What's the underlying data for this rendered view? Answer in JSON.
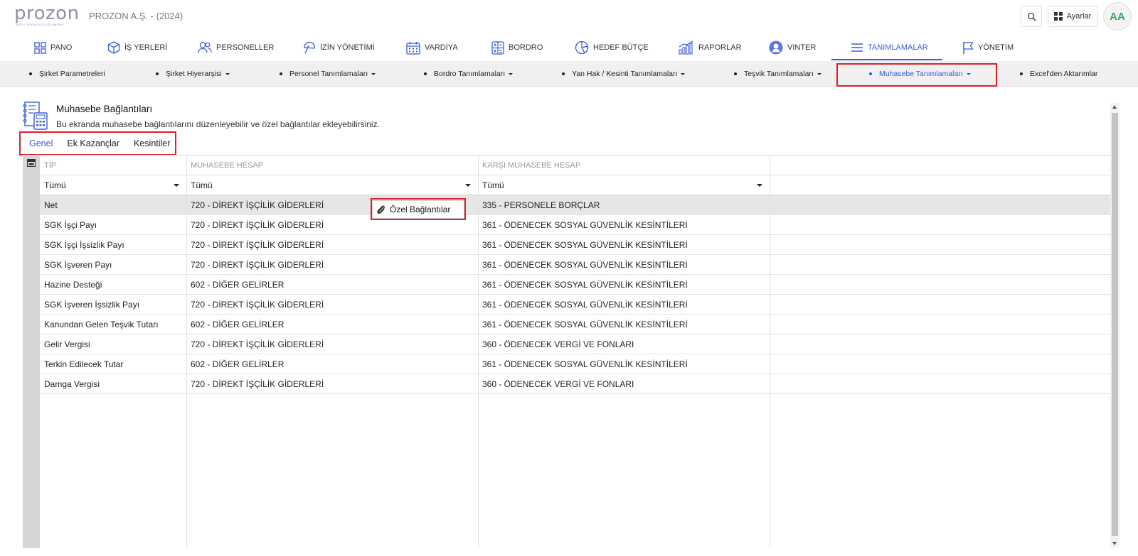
{
  "header": {
    "logo_text": "prozon",
    "logo_sub": "AKILLI TEKNOLOJİ ÇÖZÜMLERİ",
    "company": "PROZON A.Ş. - (2024)",
    "settings_label": "Ayarlar",
    "avatar_initials": "AA"
  },
  "mainnav": [
    {
      "label": "PANO",
      "icon": "dashboard-icon"
    },
    {
      "label": "İŞ YERLERİ",
      "icon": "box-icon"
    },
    {
      "label": "PERSONELLER",
      "icon": "users-icon"
    },
    {
      "label": "İZİN YÖNETİMİ",
      "icon": "beach-umbrella-icon"
    },
    {
      "label": "VARDİYA",
      "icon": "calendar-icon"
    },
    {
      "label": "BORDRO",
      "icon": "calculator-icon"
    },
    {
      "label": "HEDEF BÜTÇE",
      "icon": "pie-chart-icon"
    },
    {
      "label": "RAPORLAR",
      "icon": "bar-chart-icon"
    },
    {
      "label": "VINTER",
      "icon": "user-circle-icon"
    },
    {
      "label": "TANIMLAMALAR",
      "icon": "menu-icon",
      "active": true
    },
    {
      "label": "YÖNETİM",
      "icon": "flag-icon"
    }
  ],
  "subnav": [
    {
      "label": "Şirket Parametreleri"
    },
    {
      "label": "Şirket Hiyerarşisi"
    },
    {
      "label": "Personel Tanımlamaları"
    },
    {
      "label": "Bordro Tanımlamaları"
    },
    {
      "label": "Yan Hak / Kesinti Tanımlamaları"
    },
    {
      "label": "Teşvik Tanımlamaları"
    },
    {
      "label": "Muhasebe Tanımlamaları",
      "active": true
    },
    {
      "label": "Excel'den Aktarımlar"
    }
  ],
  "page": {
    "title": "Muhasebe Bağlantıları",
    "description": "Bu ekranda muhasebe bağlantılarını düzenleyebilir ve özel bağlantılar ekleyebilirsiniz."
  },
  "tabs": [
    {
      "label": "Genel",
      "active": true
    },
    {
      "label": "Ek Kazançlar"
    },
    {
      "label": "Kesintiler"
    }
  ],
  "grid": {
    "columns": [
      "TİP",
      "MUHASEBE HESAP",
      "KARŞI MUHASEBE HESAP"
    ],
    "filters": [
      "Tümü",
      "Tümü",
      "Tümü"
    ],
    "rows": [
      {
        "tip": "Net",
        "hesap": "720 - DİREKT İŞÇİLİK GİDERLERİ",
        "karsi": "335 - PERSONELE BORÇLAR"
      },
      {
        "tip": "SGK İşçi Payı",
        "hesap": "720 - DİREKT İŞÇİLİK GİDERLERİ",
        "karsi": "361 - ÖDENECEK SOSYAL GÜVENLİK KESİNTİLERİ"
      },
      {
        "tip": "SGK İşçi İşsizlik Payı",
        "hesap": "720 - DİREKT İŞÇİLİK GİDERLERİ",
        "karsi": "361 - ÖDENECEK SOSYAL GÜVENLİK KESİNTİLERİ"
      },
      {
        "tip": "SGK İşveren Payı",
        "hesap": "720 - DİREKT İŞÇİLİK GİDERLERİ",
        "karsi": "361 - ÖDENECEK SOSYAL GÜVENLİK KESİNTİLERİ"
      },
      {
        "tip": "Hazine Desteği",
        "hesap": "602 - DİĞER GELİRLER",
        "karsi": "361 - ÖDENECEK SOSYAL GÜVENLİK KESİNTİLERİ"
      },
      {
        "tip": "SGK İşveren İşsizlik Payı",
        "hesap": "720 - DİREKT İŞÇİLİK GİDERLERİ",
        "karsi": "361 - ÖDENECEK SOSYAL GÜVENLİK KESİNTİLERİ"
      },
      {
        "tip": "Kanundan Gelen Teşvik Tutarı",
        "hesap": "602 - DİĞER GELİRLER",
        "karsi": "361 - ÖDENECEK SOSYAL GÜVENLİK KESİNTİLERİ"
      },
      {
        "tip": "Gelir Vergisi",
        "hesap": "720 - DİREKT İŞÇİLİK GİDERLERİ",
        "karsi": "360 - ÖDENECEK VERGİ VE FONLARI"
      },
      {
        "tip": "Terkin Edilecek Tutar",
        "hesap": "602 - DİĞER GELİRLER",
        "karsi": "361 - ÖDENECEK SOSYAL GÜVENLİK KESİNTİLERİ"
      },
      {
        "tip": "Damga Vergisi",
        "hesap": "720 - DİREKT İŞÇİLİK GİDERLERİ",
        "karsi": "360 - ÖDENECEK VERGİ VE FONLARI"
      }
    ],
    "selected_row": 0
  },
  "context_menu": {
    "label": "Özel Bağlantılar",
    "icon": "paperclip-icon"
  },
  "colors": {
    "accent": "#3a5bd9",
    "highlight_box": "#e0202a",
    "avatar_text": "#3aa655"
  }
}
